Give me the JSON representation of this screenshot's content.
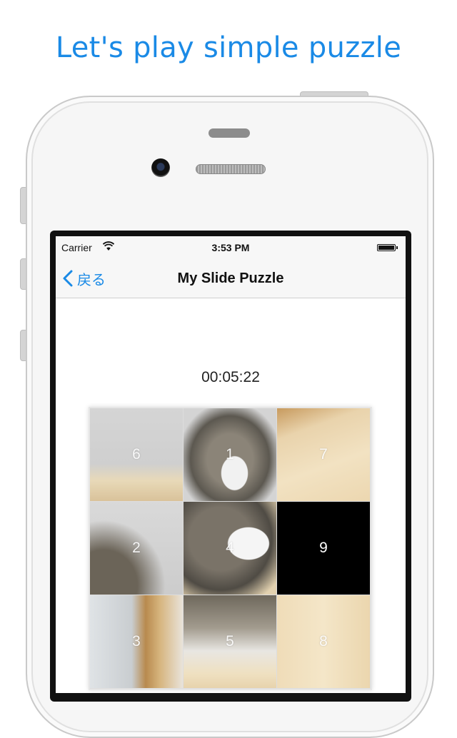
{
  "headline": "Let's play simple puzzle",
  "status_bar": {
    "carrier": "Carrier",
    "time": "3:53 PM"
  },
  "nav": {
    "back_label": "戻る",
    "title": "My Slide Puzzle"
  },
  "timer": "00:05:22",
  "board": {
    "rows": 3,
    "cols": 3,
    "tiles": [
      "6",
      "1",
      "7",
      "2",
      "4",
      "9",
      "3",
      "5",
      "8"
    ],
    "empty_tile": "9"
  },
  "colors": {
    "accent": "#1a8ae6",
    "empty_tile": "#000000"
  }
}
